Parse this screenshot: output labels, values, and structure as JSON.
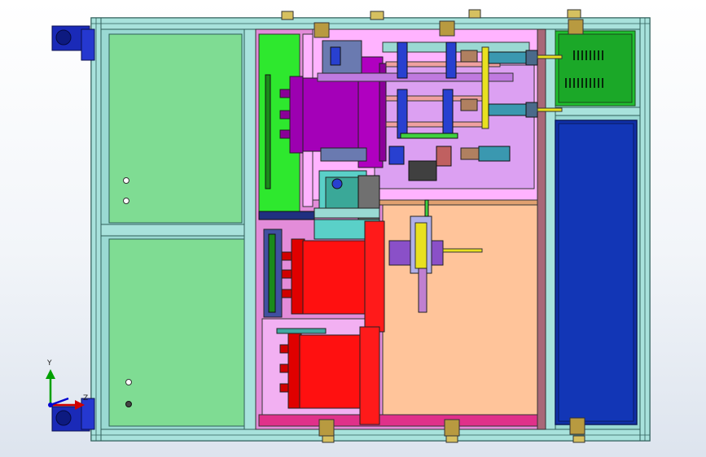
{
  "viewport": {
    "background_top": "#ffffff",
    "background_bottom": "#dde4ee"
  },
  "triad": {
    "y_label": "Y",
    "z_label": "Z",
    "x_axis_color": "#d00000",
    "y_axis_color": "#00a000",
    "z_axis_color": "#0000d0"
  },
  "colors": {
    "frame": "#9ad9d3",
    "frame_dark": "#2f5e5a",
    "left_panel": "#7fdc93",
    "green_plate": "#2ee82e",
    "pink_plate": "#ffb3ff",
    "violet_plate": "#dca0f2",
    "peach_plate": "#ffc49a",
    "purple_cylinder": "#a400b8",
    "red_cylinder": "#ff1010",
    "blue_panel": "#1030a8",
    "green_box": "#20c030",
    "motor_blue": "#1a2ab8",
    "hinge_yellow": "#d6c060"
  }
}
